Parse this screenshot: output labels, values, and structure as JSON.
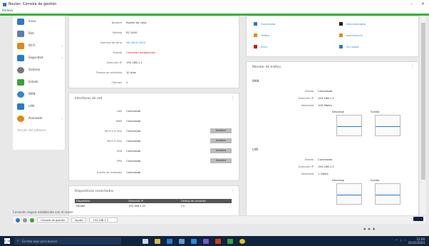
{
  "window": {
    "title": "Router: Consola de gestión",
    "menu_label": "Archivo"
  },
  "sidebar": {
    "items": [
      {
        "label": "Inicio",
        "color": "#2a7ac8",
        "icon": "home-icon"
      },
      {
        "label": "Red",
        "color": "#5b7fa0",
        "icon": "network-icon"
      },
      {
        "label": "Wi-Fi",
        "color": "#e08a10",
        "icon": "wifi-icon"
      },
      {
        "label": "Seguridad",
        "color": "#2a7ac8",
        "icon": "shield-icon"
      },
      {
        "label": "Sistema",
        "color": "#777777",
        "icon": "gear-icon"
      },
      {
        "label": "Estado",
        "color": "#3aa040",
        "icon": "status-icon"
      },
      {
        "label": "WAN",
        "color": "#2a8ad8",
        "icon": "globe-icon"
      },
      {
        "label": "LAN",
        "color": "#2a7ac8",
        "icon": "lan-icon"
      },
      {
        "label": "Avanzado",
        "color": "#e08a10",
        "icon": "advanced-icon"
      }
    ],
    "footer": "Versión del software"
  },
  "device": {
    "rows": [
      {
        "label": "Nombre",
        "value": "Router de casa"
      },
      {
        "label": "Modelo",
        "value": "RT-1000"
      },
      {
        "label": "Número de serie",
        "value": "SN 0000 0000"
      },
      {
        "label": "Estado",
        "value": "Conexión establecida",
        "alert": true
      },
      {
        "label": "Dirección IP",
        "value": "192.168.1.1"
      },
      {
        "label": "Tiempo de actividad",
        "value": "10 días"
      },
      {
        "label": "Clientes",
        "value": "2"
      }
    ]
  },
  "interfaces": {
    "title": "Interfaces de red",
    "rows": [
      {
        "label": "LAN",
        "value": "Conectado"
      },
      {
        "label": "WAN",
        "value": "Conectado"
      },
      {
        "label": "Wi-Fi 2,4 GHz",
        "value": "Conectado",
        "button": "Detalles"
      },
      {
        "label": "Wi-Fi 5 GHz",
        "value": "Conectado",
        "button": "Detalles"
      },
      {
        "label": "USB",
        "value": "Conectado",
        "button": "Detalles"
      },
      {
        "label": "VPN",
        "value": "Conectado",
        "button": "Detalles"
      },
      {
        "label": "Puerto de invitados",
        "value": "Conectado"
      }
    ]
  },
  "clients": {
    "title": "Dispositivos conectados",
    "columns": [
      "Dispositivo",
      "Dirección IP",
      "Tiempo de conexión"
    ],
    "rows": [
      [
        "Portátil",
        "192.168.1.10",
        "2 h"
      ]
    ]
  },
  "legend": {
    "items": [
      {
        "label": "Conectado",
        "color": "#2a7ac8"
      },
      {
        "label": "Desconectado",
        "color": "#222222"
      },
      {
        "label": "Tráfico",
        "color": "#e08a10"
      },
      {
        "label": "Advertencia",
        "color": "#e08a10"
      },
      {
        "label": "Error",
        "color": "#d01010"
      },
      {
        "label": "Sin datos",
        "color": "#2a7ac8"
      }
    ]
  },
  "monitor": {
    "title": "Monitor de tráfico",
    "sections": [
      {
        "name": "WAN",
        "rows": [
          {
            "label": "Estado",
            "value": "Conectado"
          },
          {
            "label": "Dirección IP",
            "value": "192.168.1.1"
          },
          {
            "label": "Velocidad",
            "value": "100 Mbit/s"
          }
        ],
        "chart_a": "Descarga",
        "chart_b": "Subida"
      },
      {
        "name": "LAN",
        "rows": [
          {
            "label": "Estado",
            "value": "Conectado"
          },
          {
            "label": "Dirección IP",
            "value": "192.168.1.1"
          },
          {
            "label": "Velocidad",
            "value": "1 Gbit/s"
          }
        ],
        "chart_a": "Descarga",
        "chart_b": "Subida"
      }
    ]
  },
  "status_bar": "Conexión segura establecida con el router",
  "browser": {
    "tabs": [
      "Consola de gestión",
      "Ayuda"
    ],
    "address": "192.168.1.1"
  },
  "taskbar": {
    "search_placeholder": "Escribe aquí para buscar",
    "time": "12:00",
    "date": "01/01/2024"
  }
}
